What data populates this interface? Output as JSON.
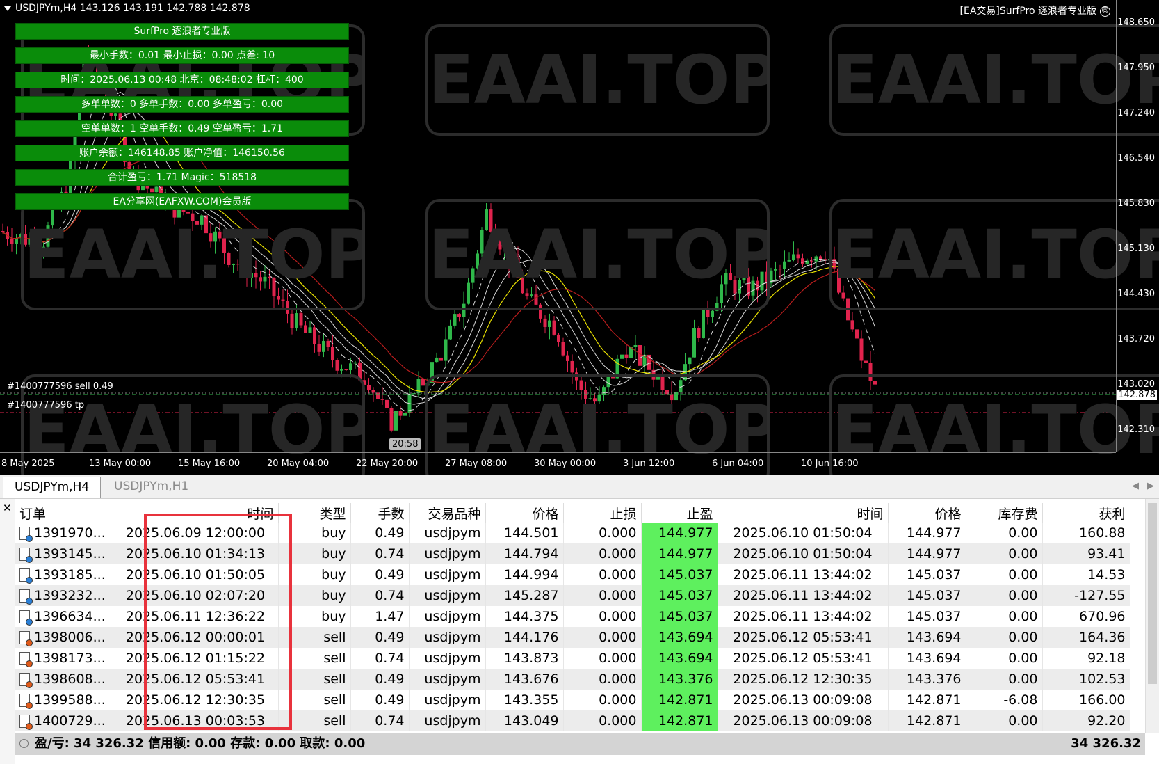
{
  "chart": {
    "title": "USDJPYm,H4  143.126 143.191 142.788 142.878",
    "ea_title": "[EA交易]SurfPro 逐浪者专业版",
    "watermark": "EAAI.TOP",
    "panel": [
      "SurfPro 逐浪者专业版",
      "最小手数：0.01  最小止损：0.00  点差: 10",
      "时间：2025.06.13 00:48  北京：08:48:02  杠杆：400",
      "多单单数：0  多单手数：0.00  多单盈亏：0.00",
      "空单单数：1  空单手数：0.49  空单盈亏：1.71",
      "账户余额：146148.85  账户净值：146150.56",
      "合计盈亏：1.71  Magic：518518",
      "EA分享网(EAFXW.COM)会员版"
    ],
    "price_ticks": [
      "148.650",
      "147.950",
      "147.240",
      "146.540",
      "145.830",
      "145.130",
      "144.430",
      "143.720",
      "143.020",
      "142.310"
    ],
    "current_price": "142.878",
    "time_ticks": [
      "8 May 2025",
      "13 May 00:00",
      "15 May 16:00",
      "20 May 04:00",
      "22 May 20:00",
      "27 May 08:00",
      "30 May 00:00",
      "3 Jun 12:00",
      "6 Jun 04:00",
      "10 Jun 16:00"
    ],
    "order_label_sell": "#1400777596 sell 0.49",
    "order_label_tp": "#1400777596 tp",
    "time_badge": "20:58",
    "colors": {
      "bull": "#2fb84a",
      "bear": "#e0234d",
      "ma_yellow": "#e8e000",
      "ma_red": "#b81d1d",
      "ma_white": "#d8d8d8",
      "panel_green": "#0a8c0a",
      "tp_cell": "#5ef05e"
    }
  },
  "tabs": [
    "USDJPYm,H4",
    "USDJPYm,H1"
  ],
  "terminal": {
    "columns": [
      "订单",
      "时间",
      "类型",
      "手数",
      "交易品种",
      "价格",
      "止损",
      "止盈",
      "时间",
      "价格",
      "库存费",
      "获利"
    ],
    "rows": [
      {
        "order": "1391970...",
        "open_time": "2025.06.09 12:00:00",
        "type": "buy",
        "lots": "0.49",
        "symbol": "usdjpym",
        "price": "144.501",
        "sl": "0.000",
        "tp": "144.977",
        "close_time": "2025.06.10 01:50:04",
        "close_price": "144.977",
        "swap": "0.00",
        "profit": "160.88"
      },
      {
        "order": "1393145...",
        "open_time": "2025.06.10 01:34:13",
        "type": "buy",
        "lots": "0.74",
        "symbol": "usdjpym",
        "price": "144.794",
        "sl": "0.000",
        "tp": "144.977",
        "close_time": "2025.06.10 01:50:04",
        "close_price": "144.977",
        "swap": "0.00",
        "profit": "93.41"
      },
      {
        "order": "1393185...",
        "open_time": "2025.06.10 01:50:05",
        "type": "buy",
        "lots": "0.49",
        "symbol": "usdjpym",
        "price": "144.994",
        "sl": "0.000",
        "tp": "145.037",
        "close_time": "2025.06.11 13:44:02",
        "close_price": "145.037",
        "swap": "0.00",
        "profit": "14.53"
      },
      {
        "order": "1393232...",
        "open_time": "2025.06.10 02:07:20",
        "type": "buy",
        "lots": "0.74",
        "symbol": "usdjpym",
        "price": "145.287",
        "sl": "0.000",
        "tp": "145.037",
        "close_time": "2025.06.11 13:44:02",
        "close_price": "145.037",
        "swap": "0.00",
        "profit": "-127.55"
      },
      {
        "order": "1396634...",
        "open_time": "2025.06.11 12:36:22",
        "type": "buy",
        "lots": "1.47",
        "symbol": "usdjpym",
        "price": "144.375",
        "sl": "0.000",
        "tp": "145.037",
        "close_time": "2025.06.11 13:44:02",
        "close_price": "145.037",
        "swap": "0.00",
        "profit": "670.96"
      },
      {
        "order": "1398006...",
        "open_time": "2025.06.12 00:00:01",
        "type": "sell",
        "lots": "0.49",
        "symbol": "usdjpym",
        "price": "144.176",
        "sl": "0.000",
        "tp": "143.694",
        "close_time": "2025.06.12 05:53:41",
        "close_price": "143.694",
        "swap": "0.00",
        "profit": "164.36"
      },
      {
        "order": "1398173...",
        "open_time": "2025.06.12 01:15:22",
        "type": "sell",
        "lots": "0.74",
        "symbol": "usdjpym",
        "price": "143.873",
        "sl": "0.000",
        "tp": "143.694",
        "close_time": "2025.06.12 05:53:41",
        "close_price": "143.694",
        "swap": "0.00",
        "profit": "92.18"
      },
      {
        "order": "1398608...",
        "open_time": "2025.06.12 05:53:41",
        "type": "sell",
        "lots": "0.49",
        "symbol": "usdjpym",
        "price": "143.676",
        "sl": "0.000",
        "tp": "143.376",
        "close_time": "2025.06.12 12:30:35",
        "close_price": "143.376",
        "swap": "0.00",
        "profit": "102.53"
      },
      {
        "order": "1399588...",
        "open_time": "2025.06.12 12:30:35",
        "type": "sell",
        "lots": "0.49",
        "symbol": "usdjpym",
        "price": "143.355",
        "sl": "0.000",
        "tp": "142.871",
        "close_time": "2025.06.13 00:09:08",
        "close_price": "142.871",
        "swap": "-6.08",
        "profit": "166.00"
      },
      {
        "order": "1400729...",
        "open_time": "2025.06.13 00:03:53",
        "type": "sell",
        "lots": "0.74",
        "symbol": "usdjpym",
        "price": "143.049",
        "sl": "0.000",
        "tp": "142.871",
        "close_time": "2025.06.13 00:09:08",
        "close_price": "142.871",
        "swap": "0.00",
        "profit": "92.20"
      }
    ],
    "summary": "盈/亏: 34 326.32  信用额: 0.00  存款: 0.00  取款: 0.00",
    "summary_total": "34 326.32"
  }
}
